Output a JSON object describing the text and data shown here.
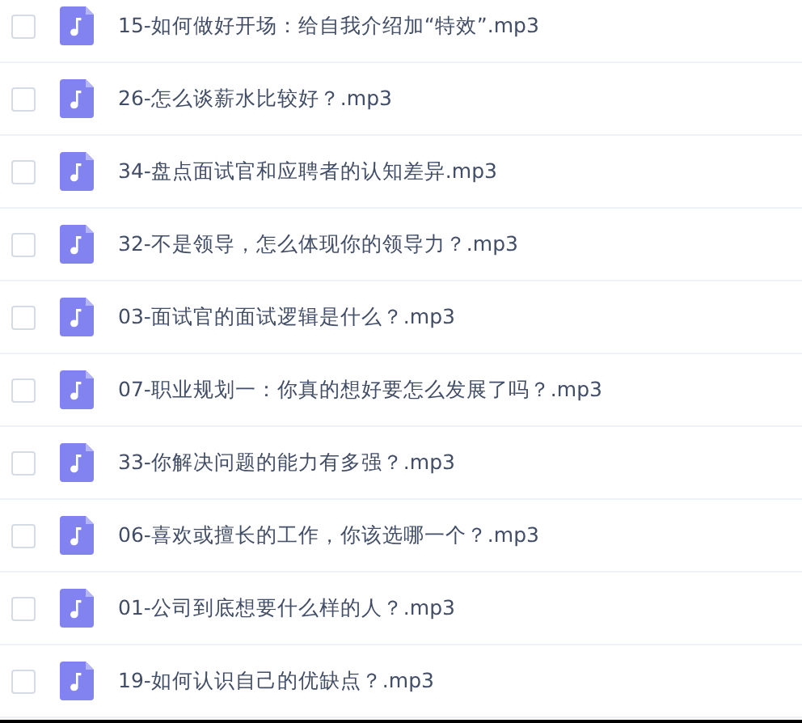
{
  "files": [
    {
      "name": "15-如何做好开场：给自我介绍加“特效”.mp3",
      "checked": false
    },
    {
      "name": "26-怎么谈薪水比较好？.mp3",
      "checked": false
    },
    {
      "name": "34-盘点面试官和应聘者的认知差异.mp3",
      "checked": false
    },
    {
      "name": "32-不是领导，怎么体现你的领导力？.mp3",
      "checked": false
    },
    {
      "name": "03-面试官的面试逻辑是什么？.mp3",
      "checked": false
    },
    {
      "name": "07-职业规划一：你真的想好要怎么发展了吗？.mp3",
      "checked": false
    },
    {
      "name": "33-你解决问题的能力有多强？.mp3",
      "checked": false
    },
    {
      "name": "06-喜欢或擅长的工作，你该选哪一个？.mp3",
      "checked": false
    },
    {
      "name": "01-公司到底想要什么样的人？.mp3",
      "checked": false
    },
    {
      "name": "19-如何认识自己的优缺点？.mp3",
      "checked": false
    }
  ]
}
